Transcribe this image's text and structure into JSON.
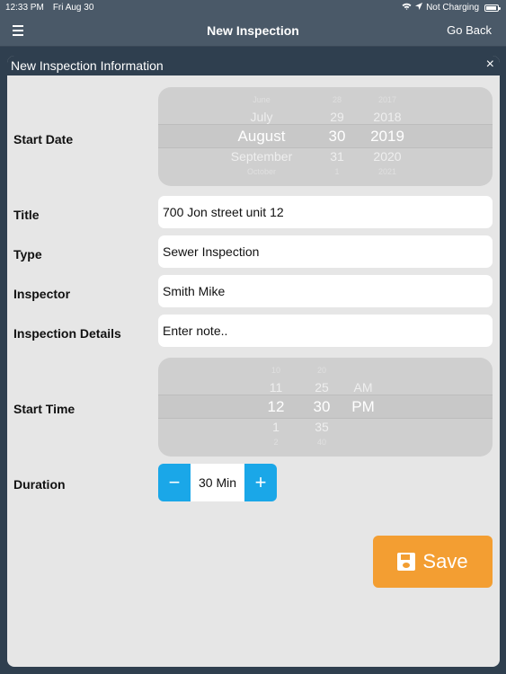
{
  "status": {
    "time": "12:33 PM",
    "date": "Fri Aug 30",
    "charging": "Not Charging",
    "battery_level": 0.9
  },
  "nav": {
    "title": "New Inspection",
    "back_label": "Go Back",
    "menu_icon": "hamburger-menu-icon"
  },
  "modal": {
    "title": "New Inspection Information",
    "close_glyph": "×"
  },
  "form": {
    "start_date_label": "Start Date",
    "start_date_picker": {
      "month": {
        "far": "June",
        "prev": "July",
        "sel": "August",
        "next": "September",
        "far2": "October"
      },
      "day": {
        "far": "28",
        "prev": "29",
        "sel": "30",
        "next": "31",
        "far2": "1"
      },
      "year": {
        "far": "2017",
        "prev": "2018",
        "sel": "2019",
        "next": "2020",
        "far2": "2021"
      }
    },
    "title_label": "Title",
    "title_value": "700 Jon street unit 12",
    "type_label": "Type",
    "type_value": "Sewer Inspection",
    "inspector_label": "Inspector",
    "inspector_value": "Smith Mike",
    "details_label": "Inspection Details",
    "details_placeholder": "Enter note..",
    "start_time_label": "Start Time",
    "start_time_picker": {
      "hour": {
        "far": "10",
        "prev": "11",
        "sel": "12",
        "next": "1",
        "far2": "2"
      },
      "minute": {
        "far": "20",
        "prev": "25",
        "sel": "30",
        "next": "35",
        "far2": "40"
      },
      "ampm": {
        "far": "",
        "prev": "AM",
        "sel": "PM",
        "next": "",
        "far2": ""
      }
    },
    "duration_label": "Duration",
    "duration_value": "30 Min",
    "minus": "−",
    "plus": "+"
  },
  "save_label": "Save",
  "colors": {
    "accent": "#1aa7e8",
    "save": "#f39e32",
    "bar": "#4a5968"
  }
}
